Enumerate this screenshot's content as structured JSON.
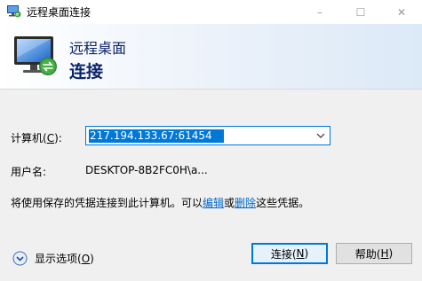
{
  "window": {
    "title": "远程桌面连接",
    "controls": {
      "minimize": "–",
      "maximize": "☐",
      "close": "✕"
    }
  },
  "banner": {
    "line1": "远程桌面",
    "line2": "连接",
    "icon": "remote-desktop-monitor-icon"
  },
  "form": {
    "computer_label_prefix": "计算机(",
    "computer_label_key": "C",
    "computer_label_suffix": "):",
    "computer_value": "217.194.133.67:61454",
    "username_label": "用户名:",
    "username_value": "DESKTOP-8B2FC0H\\a...",
    "credentials_prefix": "将使用保存的凭据连接到此计算机。可以",
    "credentials_edit": "编辑",
    "credentials_or": "或",
    "credentials_delete": "删除",
    "credentials_suffix": "这些凭据。"
  },
  "footer": {
    "options_prefix": "显示选项(",
    "options_key": "O",
    "options_suffix": ")",
    "connect_prefix": "连接(",
    "connect_key": "N",
    "connect_suffix": ")",
    "help_prefix": "帮助(",
    "help_key": "H",
    "help_suffix": ")"
  },
  "colors": {
    "accent": "#0078d7",
    "banner_text": "#0a246a",
    "link": "#0066cc"
  }
}
